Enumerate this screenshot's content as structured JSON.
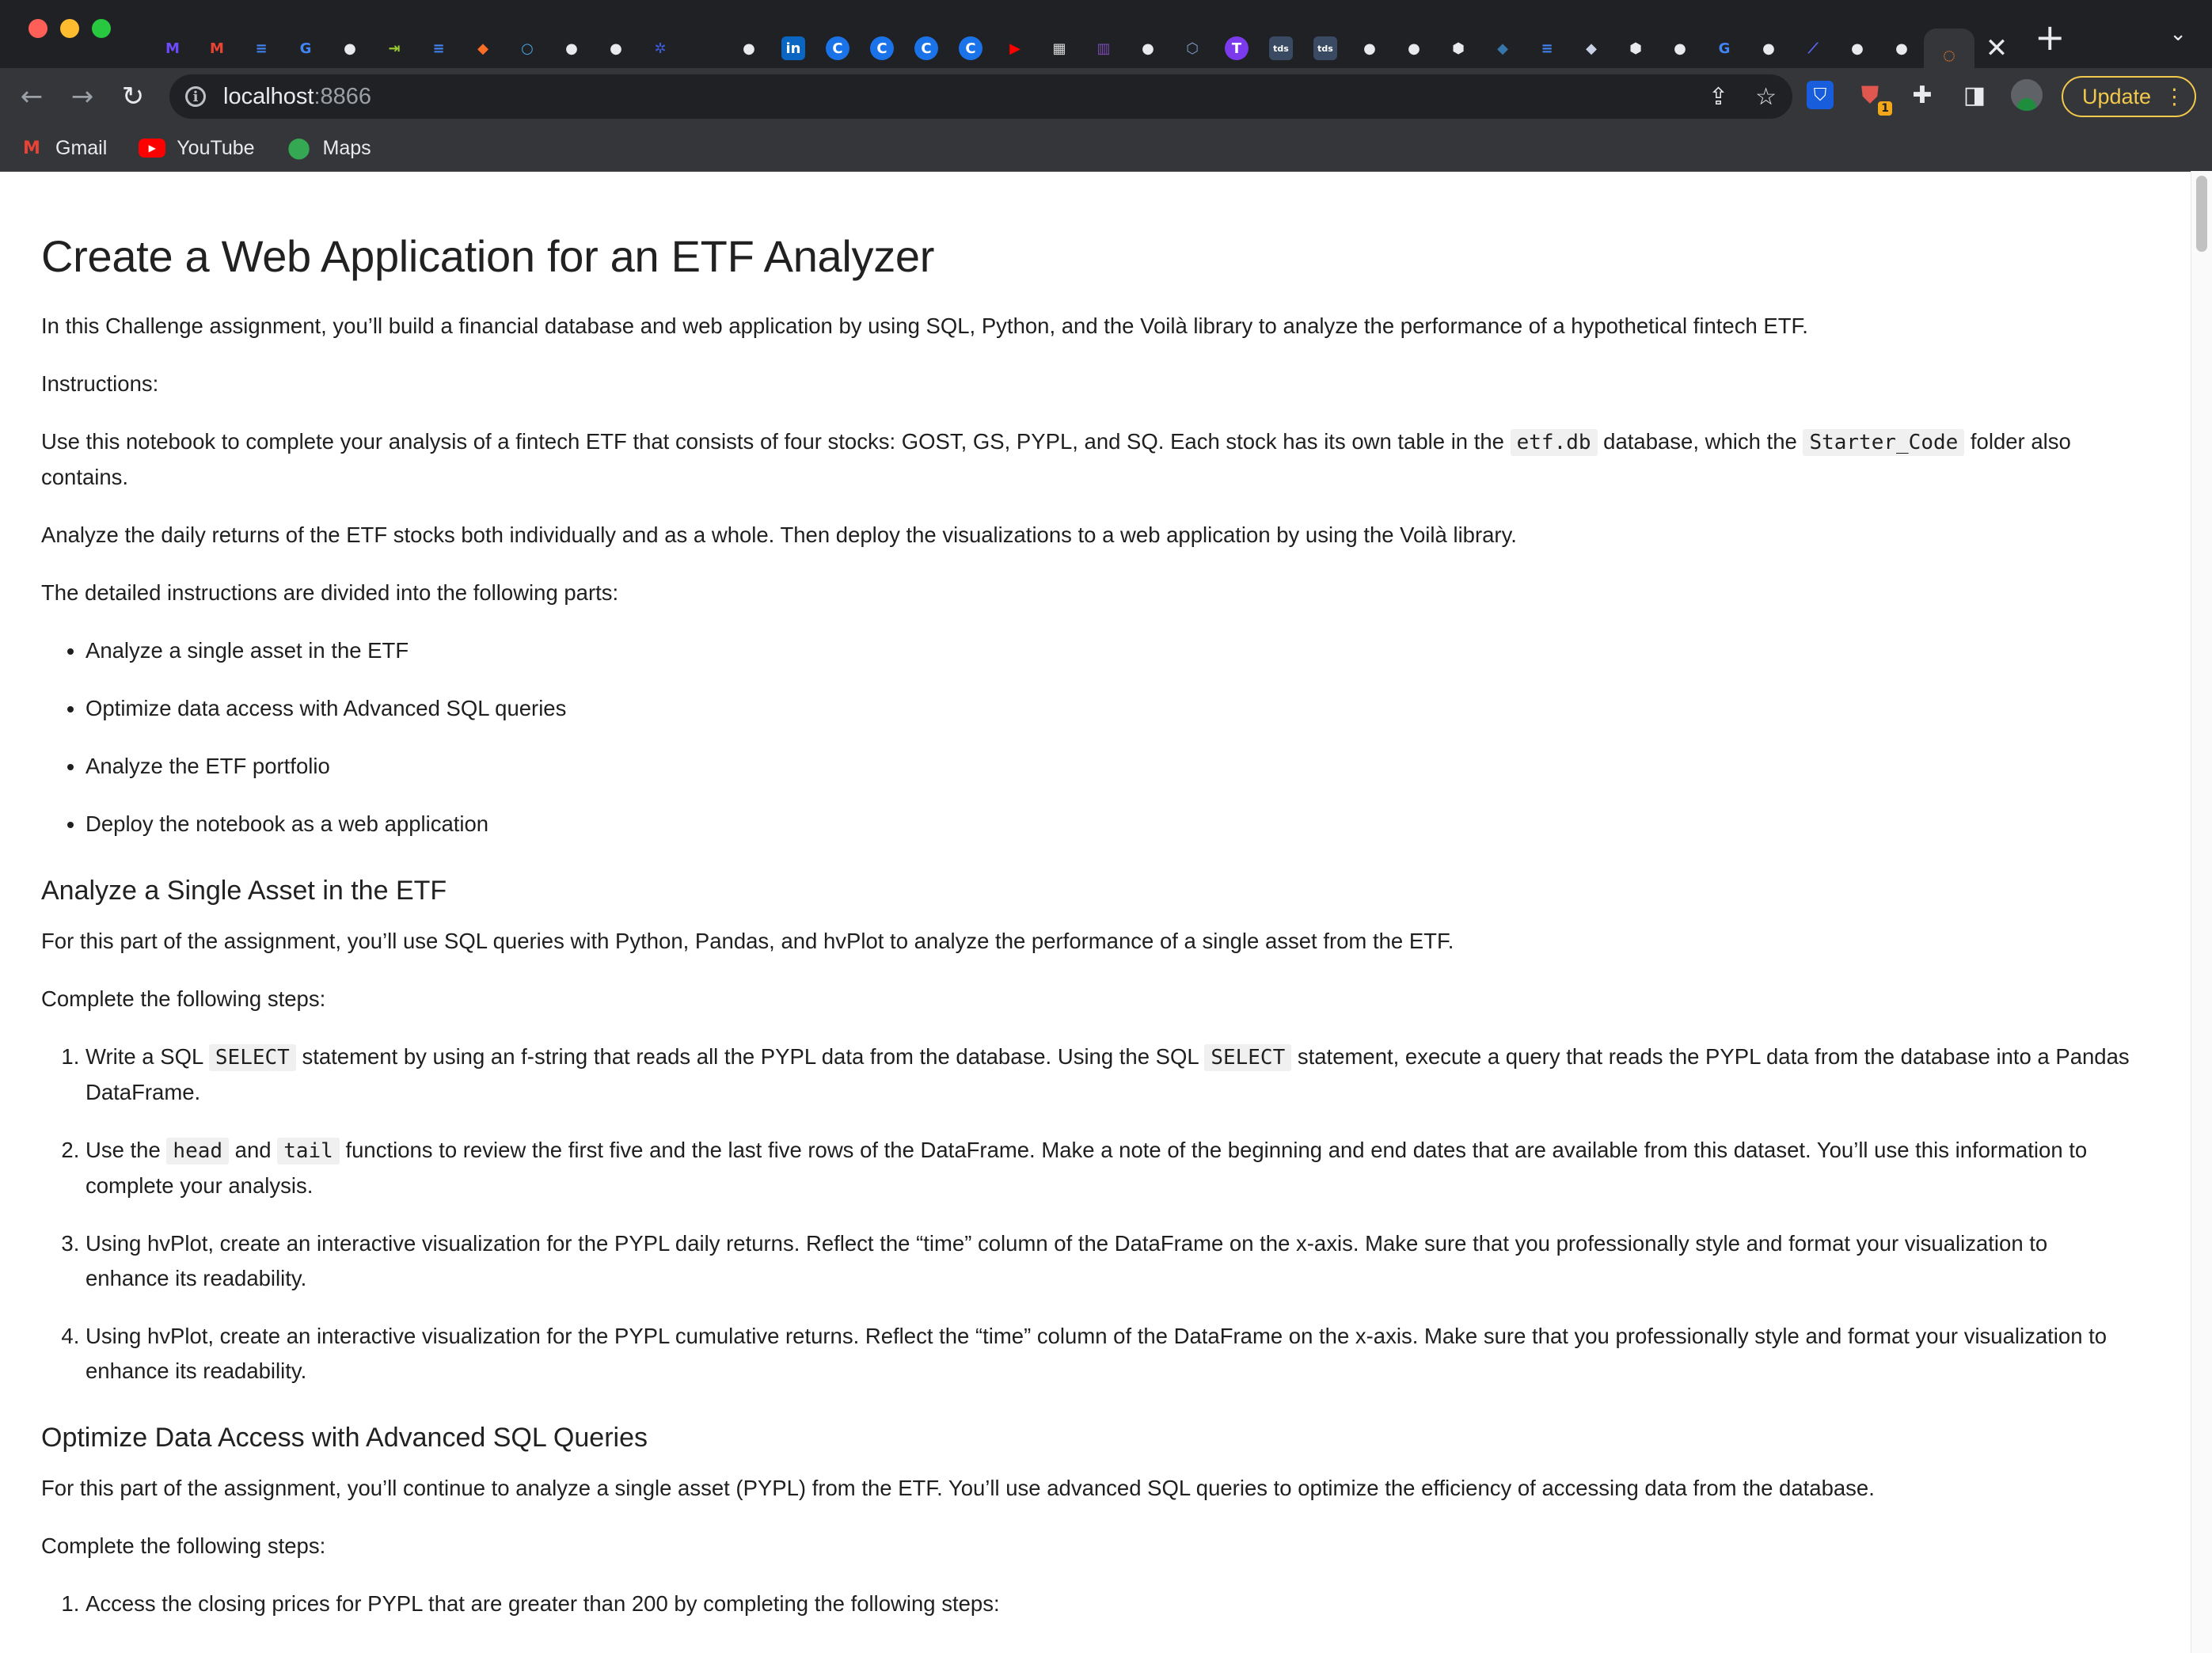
{
  "browser": {
    "tabs": [
      {
        "icon": "proton-mail-icon",
        "glyph": "M",
        "color": "#6d4aff"
      },
      {
        "icon": "gmail-icon",
        "glyph": "M",
        "color": "#ea4335"
      },
      {
        "icon": "google-docs-icon",
        "glyph": "≡",
        "color": "#4285f4"
      },
      {
        "icon": "google-icon",
        "glyph": "G",
        "color": "#4285f4"
      },
      {
        "icon": "github-icon",
        "glyph": "●",
        "color": "#e8eaed"
      },
      {
        "icon": "arrow-in-icon",
        "glyph": "⇥",
        "color": "#9acd32"
      },
      {
        "icon": "google-docs-icon",
        "glyph": "≡",
        "color": "#4285f4"
      },
      {
        "icon": "gitlab-icon",
        "glyph": "◆",
        "color": "#fc6d26"
      },
      {
        "icon": "circle-icon",
        "glyph": "○",
        "color": "#4aa3df"
      },
      {
        "icon": "github-icon",
        "glyph": "●",
        "color": "#e8eaed"
      },
      {
        "icon": "github-icon",
        "glyph": "●",
        "color": "#e8eaed"
      },
      {
        "icon": "star-mark-icon",
        "glyph": "✲",
        "color": "#3b5bdb"
      },
      {
        "icon": "blank-icon",
        "glyph": "",
        "color": "#2b2b2b"
      },
      {
        "icon": "github-icon",
        "glyph": "●",
        "color": "#e8eaed"
      },
      {
        "icon": "linkedin-icon",
        "glyph": "in",
        "color": "#0a66c2"
      },
      {
        "icon": "c-icon",
        "glyph": "C",
        "color": "#1a73e8"
      },
      {
        "icon": "c-icon",
        "glyph": "C",
        "color": "#1a73e8"
      },
      {
        "icon": "c-icon",
        "glyph": "C",
        "color": "#1a73e8"
      },
      {
        "icon": "c-icon",
        "glyph": "C",
        "color": "#1a73e8"
      },
      {
        "icon": "youtube-icon",
        "glyph": "▶",
        "color": "#ff0000"
      },
      {
        "icon": "pattern-icon",
        "glyph": "▦",
        "color": "#dddddd"
      },
      {
        "icon": "pixel-icon",
        "glyph": "▥",
        "color": "#7b4bb7"
      },
      {
        "icon": "github-icon",
        "glyph": "●",
        "color": "#e8eaed"
      },
      {
        "icon": "cube-icon",
        "glyph": "⬡",
        "color": "#7a9cc6"
      },
      {
        "icon": "t-icon",
        "glyph": "T",
        "color": "#7c3aed"
      },
      {
        "icon": "tds-icon",
        "glyph": "tds",
        "color": "#3b4a63"
      },
      {
        "icon": "tds-icon",
        "glyph": "tds",
        "color": "#3b4a63"
      },
      {
        "icon": "github-icon",
        "glyph": "●",
        "color": "#e8eaed"
      },
      {
        "icon": "github-icon",
        "glyph": "●",
        "color": "#e8eaed"
      },
      {
        "icon": "hexagon-icon",
        "glyph": "⬢",
        "color": "#e8eaed"
      },
      {
        "icon": "python-icon",
        "glyph": "◆",
        "color": "#3776ab"
      },
      {
        "icon": "google-docs-icon",
        "glyph": "≡",
        "color": "#4285f4"
      },
      {
        "icon": "python-icon",
        "glyph": "◆",
        "color": "#c9d1e6"
      },
      {
        "icon": "hexagon-icon",
        "glyph": "⬢",
        "color": "#e8eaed"
      },
      {
        "icon": "github-icon",
        "glyph": "●",
        "color": "#e8eaed"
      },
      {
        "icon": "google-icon",
        "glyph": "G",
        "color": "#4285f4"
      },
      {
        "icon": "github-icon",
        "glyph": "●",
        "color": "#e8eaed"
      },
      {
        "icon": "feather-icon",
        "glyph": "⟋",
        "color": "#5865f2"
      },
      {
        "icon": "github-icon",
        "glyph": "●",
        "color": "#e8eaed"
      },
      {
        "icon": "github-icon",
        "glyph": "●",
        "color": "#e8eaed"
      },
      {
        "icon": "jupyter-icon",
        "glyph": "◌",
        "color": "#f37726"
      }
    ],
    "address": {
      "host": "localhost",
      "port": ":8866"
    },
    "update_label": "Update",
    "extension_badge": "1",
    "bookmarks": [
      {
        "label": "Gmail",
        "icon": "gmail-icon"
      },
      {
        "label": "YouTube",
        "icon": "youtube-icon"
      },
      {
        "label": "Maps",
        "icon": "maps-icon"
      }
    ]
  },
  "page": {
    "title": "Create a Web Application for an ETF Analyzer",
    "intro": "In this Challenge assignment, you’ll build a financial database and web application by using SQL, Python, and the Voilà library to analyze the performance of a hypothetical fintech ETF.",
    "instructions_label": "Instructions:",
    "use_notebook": {
      "part1": "Use this notebook to complete your analysis of a fintech ETF that consists of four stocks: GOST, GS, PYPL, and SQ. Each stock has its own table in the ",
      "code1": "etf.db",
      "part2": " database, which the ",
      "code2": "Starter_Code",
      "part3": " folder also contains."
    },
    "analyze_daily": "Analyze the daily returns of the ETF stocks both individually and as a whole. Then deploy the visualizations to a web application by using the Voilà library.",
    "parts_intro": "The detailed instructions are divided into the following parts:",
    "parts": [
      "Analyze a single asset in the ETF",
      "Optimize data access with Advanced SQL queries",
      "Analyze the ETF portfolio",
      "Deploy the notebook as a web application"
    ],
    "section1": {
      "heading": "Analyze a Single Asset in the ETF",
      "intro": "For this part of the assignment, you’ll use SQL queries with Python, Pandas, and hvPlot to analyze the performance of a single asset from the ETF.",
      "steps_label": "Complete the following steps:",
      "step1": {
        "a": "Write a SQL ",
        "code1": "SELECT",
        "b": " statement by using an f-string that reads all the PYPL data from the database. Using the SQL ",
        "code2": "SELECT",
        "c": " statement, execute a query that reads the PYPL data from the database into a Pandas DataFrame."
      },
      "step2": {
        "a": "Use the ",
        "code1": "head",
        "b": " and ",
        "code2": "tail",
        "c": " functions to review the first five and the last five rows of the DataFrame. Make a note of the beginning and end dates that are available from this dataset. You’ll use this information to complete your analysis."
      },
      "step3": "Using hvPlot, create an interactive visualization for the PYPL daily returns. Reflect the “time” column of the DataFrame on the x-axis. Make sure that you professionally style and format your visualization to enhance its readability.",
      "step4": "Using hvPlot, create an interactive visualization for the PYPL cumulative returns. Reflect the “time” column of the DataFrame on the x-axis. Make sure that you professionally style and format your visualization to enhance its readability."
    },
    "section2": {
      "heading": "Optimize Data Access with Advanced SQL Queries",
      "intro": "For this part of the assignment, you’ll continue to analyze a single asset (PYPL) from the ETF. You’ll use advanced SQL queries to optimize the efficiency of accessing data from the database.",
      "steps_label": "Complete the following steps:",
      "step1": "Access the closing prices for PYPL that are greater than 200 by completing the following steps:"
    }
  }
}
